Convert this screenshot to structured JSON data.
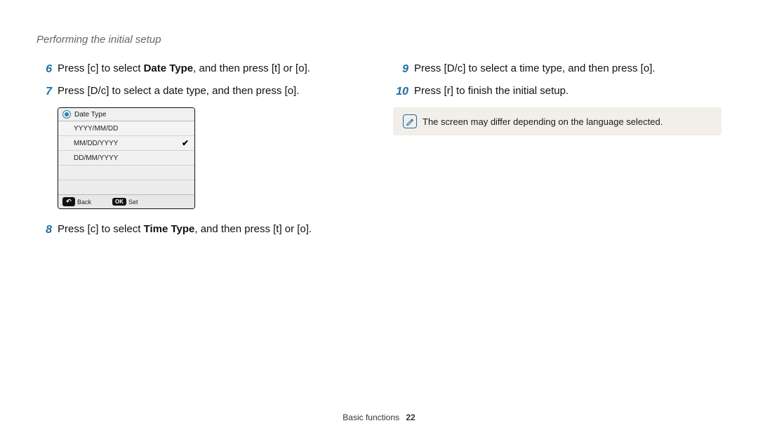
{
  "header": {
    "title": "Performing the initial setup"
  },
  "left": {
    "steps": [
      {
        "num": "6",
        "pre": "Press [",
        "btn1": "c",
        "mid1": "] to select ",
        "bold": "Date Type",
        "mid2": ", and then press [",
        "btn2": "t",
        "mid3": "] or [",
        "btn3": "o",
        "post": "]."
      },
      {
        "num": "7",
        "pre": "Press [",
        "btn1": "D",
        "mid1": "/",
        "btn2": "c",
        "mid2": "] to select a date type, and then press [",
        "btn3": "o",
        "post": "]."
      },
      {
        "num": "8",
        "pre": "Press [",
        "btn1": "c",
        "mid1": "] to select ",
        "bold": "Time Type",
        "mid2": ", and then press [",
        "btn2": "t",
        "mid3": "] or [",
        "btn3": "o",
        "post": "]."
      }
    ]
  },
  "screen": {
    "header": "Date Type",
    "options": [
      {
        "label": "YYYY/MM/DD",
        "selected": false
      },
      {
        "label": "MM/DD/YYYY",
        "selected": true
      },
      {
        "label": "DD/MM/YYYY",
        "selected": false
      }
    ],
    "footer": {
      "back_key": "↶",
      "back_label": "Back",
      "ok_key": "OK",
      "set_label": "Set"
    }
  },
  "right": {
    "steps": [
      {
        "num": "9",
        "pre": "Press [",
        "btn1": "D",
        "mid1": "/",
        "btn2": "c",
        "mid2": "] to select a time type, and then press [",
        "btn3": "o",
        "post": "]."
      },
      {
        "num": "10",
        "pre": "Press [",
        "btn1": "r",
        "mid1": "] to finish the initial setup.",
        "btn2": "",
        "mid2": "",
        "btn3": "",
        "post": ""
      }
    ],
    "note": "The screen may differ depending on the language selected."
  },
  "footer": {
    "section": "Basic functions",
    "page": "22"
  }
}
